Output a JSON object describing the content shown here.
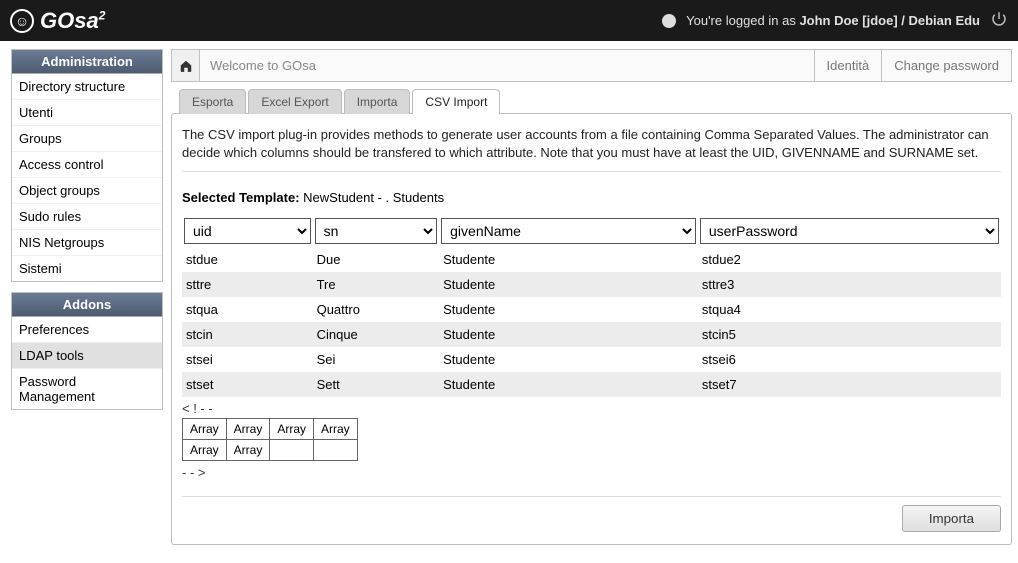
{
  "topbar": {
    "app_name": "GOsa",
    "sup": "2",
    "logged_in_prefix": "You're logged in as ",
    "user": "John Doe [jdoe] / Debian Edu"
  },
  "sidebar": {
    "admin_header": "Administration",
    "admin_items": [
      "Directory structure",
      "Utenti",
      "Groups",
      "Access control",
      "Object groups",
      "Sudo rules",
      "NIS Netgroups",
      "Sistemi"
    ],
    "addons_header": "Addons",
    "addons_items": [
      "Preferences",
      "LDAP tools",
      "Password Management"
    ],
    "addons_selected_index": 1
  },
  "breadcrumb": {
    "welcome": "Welcome to GOsa",
    "links": [
      "Identità",
      "Change password"
    ]
  },
  "tabs": {
    "items": [
      "Esporta",
      "Excel Export",
      "Importa",
      "CSV Import"
    ],
    "active_index": 3
  },
  "panel": {
    "description": "The CSV import plug-in provides methods to generate user accounts from a file containing Comma Separated Values. The administrator can decide which columns should be transfered to which attribute. Note that you must have at least the UID, GIVENNAME and SURNAME set.",
    "selected_label": "Selected Template:",
    "selected_value": "NewStudent - . Students",
    "columns": [
      "uid",
      "sn",
      "givenName",
      "userPassword"
    ],
    "rows": [
      [
        "stdue",
        "Due",
        "Studente",
        "stdue2"
      ],
      [
        "sttre",
        "Tre",
        "Studente",
        "sttre3"
      ],
      [
        "stqua",
        "Quattro",
        "Studente",
        "stqua4"
      ],
      [
        "stcin",
        "Cinque",
        "Studente",
        "stcin5"
      ],
      [
        "stsei",
        "Sei",
        "Studente",
        "stsei6"
      ],
      [
        "stset",
        "Sett",
        "Studente",
        "stset7"
      ]
    ],
    "debug_open": "< ! - -",
    "debug_close": "- - >",
    "debug_table": [
      [
        "Array",
        "Array",
        "Array",
        "Array"
      ],
      [
        "Array",
        "Array",
        "",
        ""
      ]
    ],
    "import_button": "Importa"
  }
}
